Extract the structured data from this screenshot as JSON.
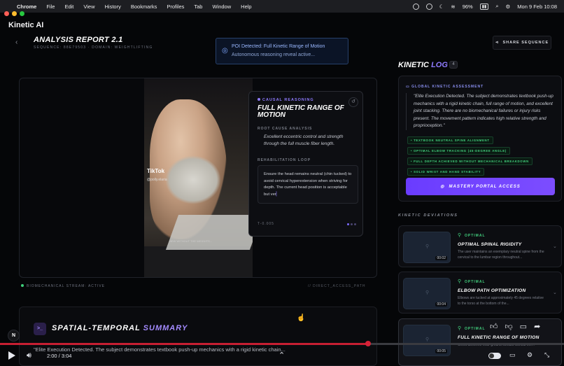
{
  "menubar": {
    "app": "Chrome",
    "items": [
      "File",
      "Edit",
      "View",
      "History",
      "Bookmarks",
      "Profiles",
      "Tab",
      "Window",
      "Help"
    ],
    "battery": "96%",
    "clock": "Mon 9 Feb 10:08"
  },
  "app_title": "Kinetic AI",
  "header": {
    "title": "ANALYSIS REPORT 2.1",
    "subtitle": "SEQUENCE: 88E79503 · DOMAIN: WEIGHTLIFTING",
    "share_label": "SHARE SEQUENCE"
  },
  "poi": {
    "line1": "POI Detected: Full Kinetic Range of Motion",
    "line2": "Autonomous reasoning reveal active..."
  },
  "video": {
    "tiktok": "TikTok",
    "tiktok_user": "@polly.elaria",
    "caption": "NEW WITHOUT THE WEIGHTS..."
  },
  "reasoning": {
    "tag": "CAUSAL REASONING",
    "title": "FULL KINETIC RANGE OF MOTION",
    "rca_heading": "ROOT CAUSE ANALYSIS",
    "rca_text": "Excellent eccentric control and strength through the full muscle fiber length.",
    "rehab_heading": "REHABILITATION LOOP",
    "rehab_text": "Ensure the head remains neutral (chin tucked) to avoid cervical hyperextension when striving for depth. The current head position is acceptable but ver",
    "timestamp": "T-0.005"
  },
  "stream": {
    "left": "BIOMECHANICAL STREAM: ACTIVE",
    "right": "// DIRECT_ACCESS_PATH"
  },
  "summary": {
    "title_a": "SPATIAL-TEMPORAL ",
    "title_b": "SUMMARY",
    "text": "\"Elite Execution Detected. The subject demonstrates textbook push-up mechanics with a rigid kinetic chain..."
  },
  "log": {
    "title_a": "KINETIC ",
    "title_b": "LOG",
    "count": "4",
    "assessment_heading": "GLOBAL KINETIC ASSESSMENT",
    "quote": "\"Elite Execution Detected. The subject demonstrates textbook push-up mechanics with a rigid kinetic chain, full range of motion, and excellent joint stacking. There are no biomechanical failures or injury risks present. The movement pattern indicates high relative strength and proprioception.\"",
    "tags": [
      "• TEXTBOOK NEUTRAL SPINE ALIGNMENT",
      "• OPTIMAL ELBOW TRACKING (45-DEGREE ANGLE)",
      "• FULL DEPTH ACHIEVED WITHOUT MECHANICAL BREAKDOWN",
      "• SOLID WRIST AND HAND STABILITY"
    ],
    "mastery_label": "MASTERY PORTAL ACCESS"
  },
  "deviations": {
    "heading": "KINETIC DEVIATIONS",
    "items": [
      {
        "status": "OPTIMAL",
        "title": "OPTIMAL SPINAL RIGIDITY",
        "desc": "The user maintains an exemplary neutral spine from the cervical to the lumbar region throughout...",
        "time": "00:02"
      },
      {
        "status": "OPTIMAL",
        "title": "ELBOW PATH OPTIMIZATION",
        "desc": "Elbows are tucked at approximately 45 degrees relative to the torso at the bottom of the...",
        "time": "00:04"
      },
      {
        "status": "OPTIMAL",
        "title": "FULL KINETIC RANGE OF MOTION",
        "desc": "Chest achieves near-ground contact without the...",
        "time": "00:05"
      }
    ]
  },
  "player": {
    "time": "2:00 / 3:04",
    "progress": 0.652,
    "n_badge": "N"
  },
  "colors": {
    "accent": "#8f7bff",
    "optimal": "#43d17f",
    "progress": "#c61f32"
  }
}
